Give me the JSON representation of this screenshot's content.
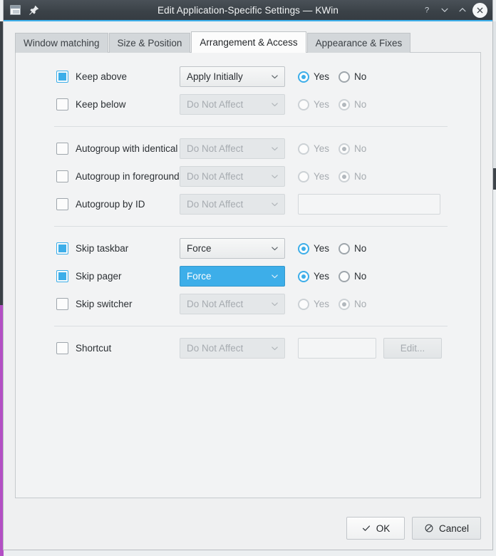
{
  "window": {
    "title": "Edit Application-Specific Settings — KWin",
    "icons": {
      "app": "window-icon",
      "pin": "pin-icon",
      "help": "help-icon",
      "minimize": "chevron-down-icon",
      "maximize": "chevron-up-icon",
      "close": "close-icon"
    },
    "accent_color": "#3daee9",
    "titlebar_color": "#3b4248"
  },
  "tabs": [
    {
      "label": "Window matching",
      "active": false
    },
    {
      "label": "Size & Position",
      "active": false
    },
    {
      "label": "Arrangement & Access",
      "active": true
    },
    {
      "label": "Appearance & Fixes",
      "active": false
    }
  ],
  "groups": [
    {
      "rows": [
        {
          "label": "Keep above",
          "checked": true,
          "combo": {
            "value": "Apply Initially",
            "disabled": false,
            "highlighted": false
          },
          "control": "radio",
          "radios": {
            "yes_label": "Yes",
            "no_label": "No",
            "selected": "yes",
            "disabled": false
          }
        },
        {
          "label": "Keep below",
          "checked": false,
          "combo": {
            "value": "Do Not Affect",
            "disabled": true,
            "highlighted": false
          },
          "control": "radio",
          "radios": {
            "yes_label": "Yes",
            "no_label": "No",
            "selected": "no",
            "disabled": true
          }
        }
      ]
    },
    {
      "rows": [
        {
          "label": "Autogroup with identical",
          "checked": false,
          "combo": {
            "value": "Do Not Affect",
            "disabled": true,
            "highlighted": false
          },
          "control": "radio",
          "radios": {
            "yes_label": "Yes",
            "no_label": "No",
            "selected": "no",
            "disabled": true
          }
        },
        {
          "label": "Autogroup in foreground",
          "checked": false,
          "combo": {
            "value": "Do Not Affect",
            "disabled": true,
            "highlighted": false
          },
          "control": "radio",
          "radios": {
            "yes_label": "Yes",
            "no_label": "No",
            "selected": "no",
            "disabled": true
          }
        },
        {
          "label": "Autogroup by ID",
          "checked": false,
          "combo": {
            "value": "Do Not Affect",
            "disabled": true,
            "highlighted": false
          },
          "control": "text",
          "text": {
            "value": "",
            "placeholder": ""
          }
        }
      ]
    },
    {
      "rows": [
        {
          "label": "Skip taskbar",
          "checked": true,
          "combo": {
            "value": "Force",
            "disabled": false,
            "highlighted": false
          },
          "control": "radio",
          "radios": {
            "yes_label": "Yes",
            "no_label": "No",
            "selected": "yes",
            "disabled": false
          }
        },
        {
          "label": "Skip pager",
          "checked": true,
          "combo": {
            "value": "Force",
            "disabled": false,
            "highlighted": true
          },
          "control": "radio",
          "radios": {
            "yes_label": "Yes",
            "no_label": "No",
            "selected": "yes",
            "disabled": false
          }
        },
        {
          "label": "Skip switcher",
          "checked": false,
          "combo": {
            "value": "Do Not Affect",
            "disabled": true,
            "highlighted": false
          },
          "control": "radio",
          "radios": {
            "yes_label": "Yes",
            "no_label": "No",
            "selected": "no",
            "disabled": true
          }
        }
      ]
    },
    {
      "rows": [
        {
          "label": "Shortcut",
          "checked": false,
          "combo": {
            "value": "Do Not Affect",
            "disabled": true,
            "highlighted": false
          },
          "control": "text-button",
          "text": {
            "value": "",
            "placeholder": ""
          },
          "button": {
            "label": "Edit...",
            "disabled": true
          }
        }
      ]
    }
  ],
  "footer": {
    "ok_label": "OK",
    "cancel_label": "Cancel",
    "ok_icon": "check-icon",
    "cancel_icon": "prohibition-icon"
  }
}
